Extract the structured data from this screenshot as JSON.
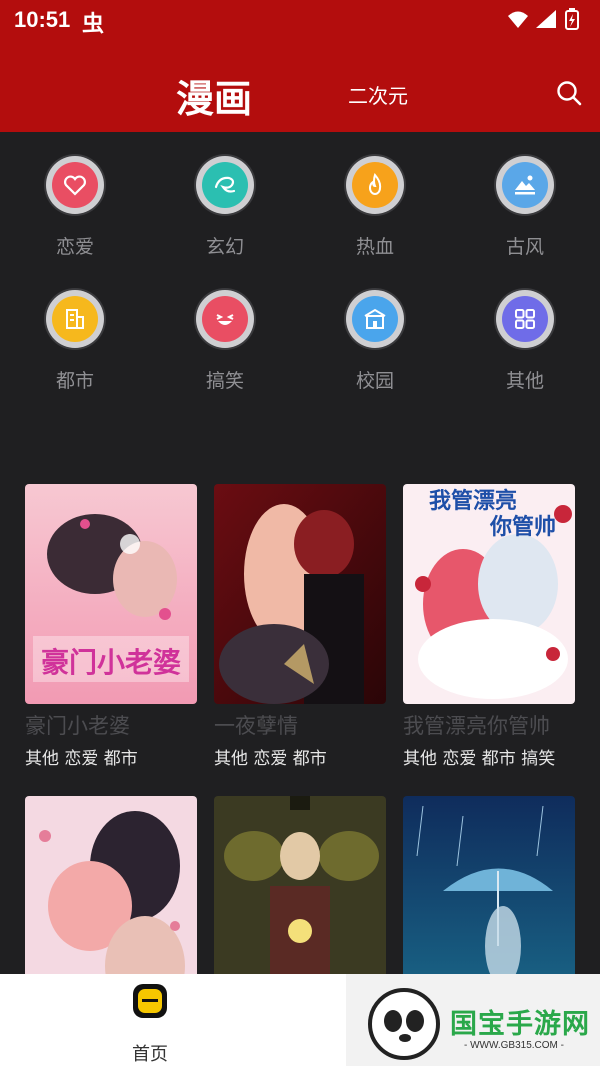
{
  "status_bar": {
    "time": "10:51",
    "bug_glyph": "虫"
  },
  "header": {
    "title": "漫画",
    "subtab": "二次元"
  },
  "categories": [
    {
      "label": "恋爱",
      "icon": "heart-icon",
      "color": "#e94e63"
    },
    {
      "label": "玄幻",
      "icon": "swirl-icon",
      "color": "#2bbfb1"
    },
    {
      "label": "热血",
      "icon": "flame-icon",
      "color": "#f7a21b"
    },
    {
      "label": "古风",
      "icon": "mountain-icon",
      "color": "#5aa7e8"
    },
    {
      "label": "都市",
      "icon": "building-icon",
      "color": "#f6b81d"
    },
    {
      "label": "搞笑",
      "icon": "laugh-face-icon",
      "color": "#e94e63"
    },
    {
      "label": "校园",
      "icon": "school-icon",
      "color": "#4aa5ec"
    },
    {
      "label": "其他",
      "icon": "grid-icon",
      "color": "#6f6ce8"
    }
  ],
  "comics": [
    {
      "title": "豪门小老婆",
      "tags": "其他 恋爱 都市",
      "cover_text": "豪门小老婆"
    },
    {
      "title": "一夜孽情",
      "tags": "其他 恋爱 都市",
      "cover_text": ""
    },
    {
      "title": "我管漂亮你管帅",
      "tags": "其他 恋爱 都市 搞笑",
      "cover_text": "我管漂亮你管帅"
    },
    {
      "title": "",
      "tags": "",
      "cover_text": ""
    },
    {
      "title": "",
      "tags": "",
      "cover_text": ""
    },
    {
      "title": "",
      "tags": "",
      "cover_text": ""
    }
  ],
  "bottom_nav": {
    "home_label": "首页"
  },
  "watermark": {
    "brand": "国宝手游网",
    "url": "- WWW.GB315.COM -"
  },
  "colors": {
    "header_bg": "#b30d0d",
    "page_bg": "#1f1f21",
    "accent_yellow": "#f6c700"
  }
}
